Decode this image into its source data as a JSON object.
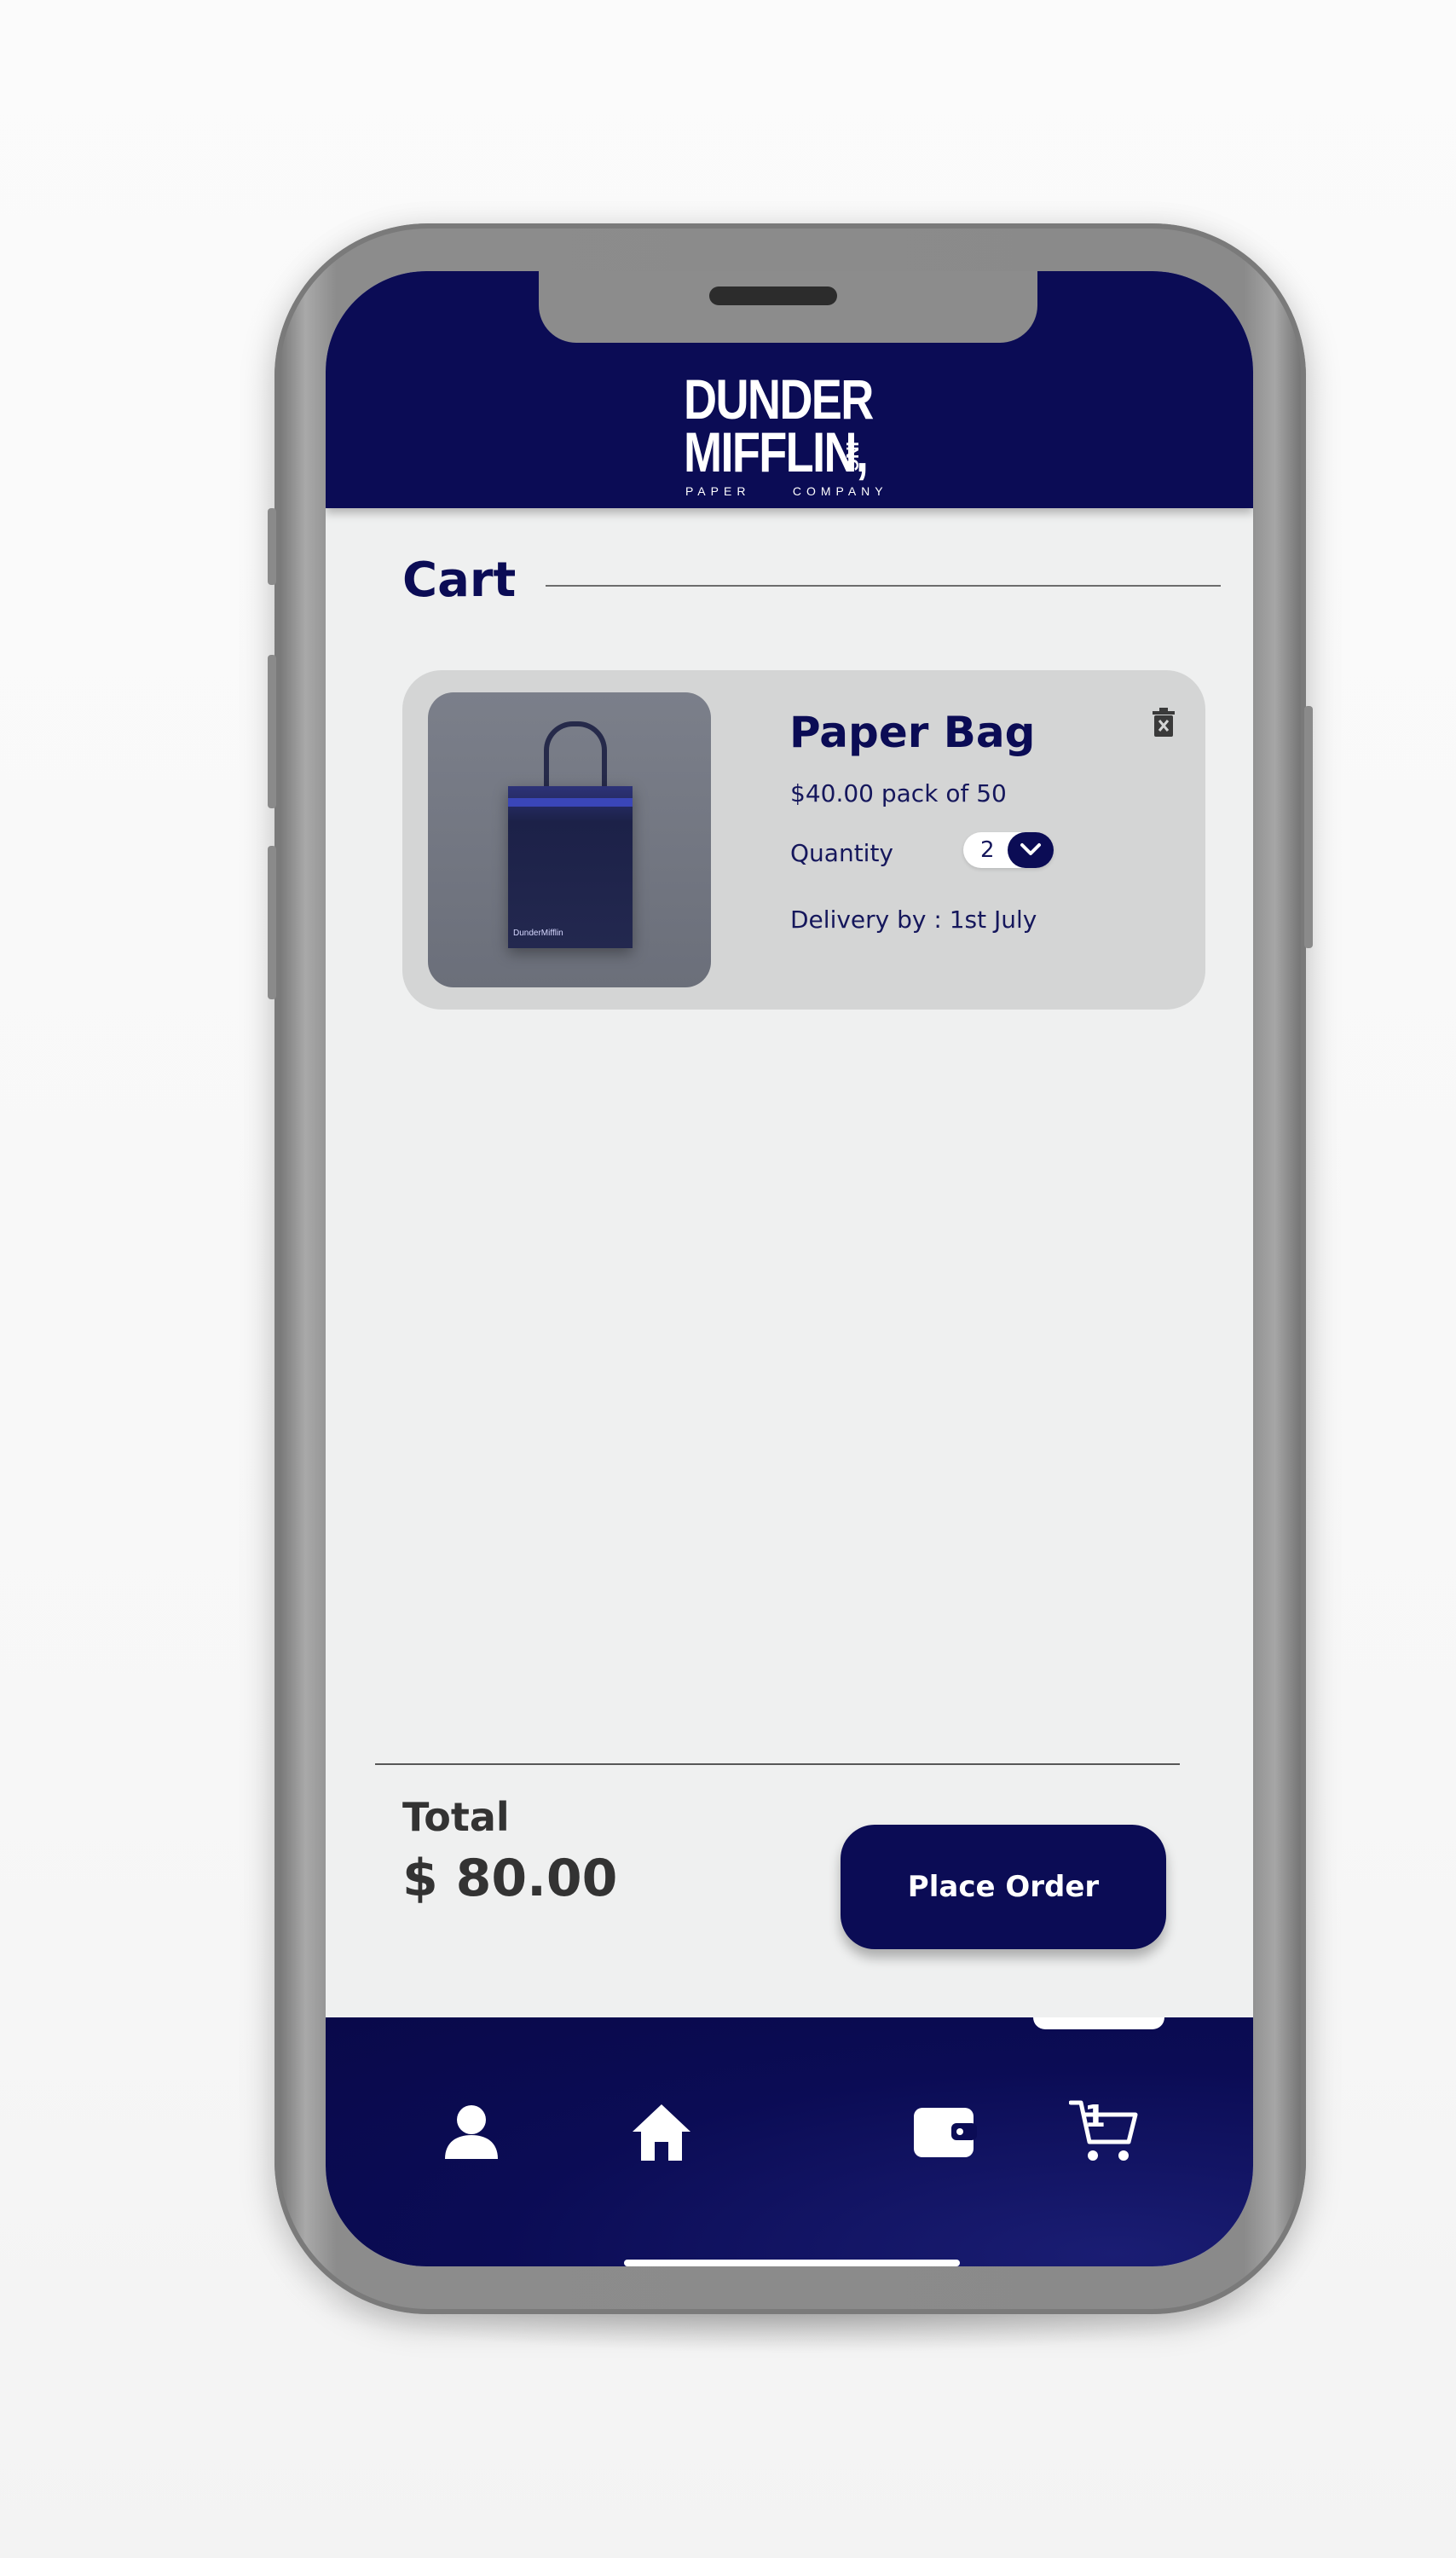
{
  "app": {
    "brand_line1": "DUNDER",
    "brand_line2": "MIFFLIN,",
    "brand_suffix": "INC",
    "brand_tagline": "PAPER     COMPANY"
  },
  "page": {
    "title": "Cart"
  },
  "cart_item": {
    "name": "Paper Bag",
    "price": "$40.00 pack of 50",
    "quantity_label": "Quantity",
    "quantity_value": "2",
    "delivery": "Delivery  by : 1st July",
    "image_label": "DunderMifflin"
  },
  "summary": {
    "total_label": "Total",
    "total_value": "$ 80.00",
    "place_order_label": "Place Order"
  },
  "nav": {
    "items": [
      {
        "icon": "user-icon"
      },
      {
        "icon": "home-icon"
      },
      {
        "icon": "wallet-icon"
      },
      {
        "icon": "cart-icon",
        "badge": "1"
      }
    ],
    "active": "cart"
  },
  "colors": {
    "brand_navy": "#0b0c55",
    "screen_bg": "#eff0f0",
    "card_bg": "#d4d5d5",
    "text_dark": "#333333"
  }
}
